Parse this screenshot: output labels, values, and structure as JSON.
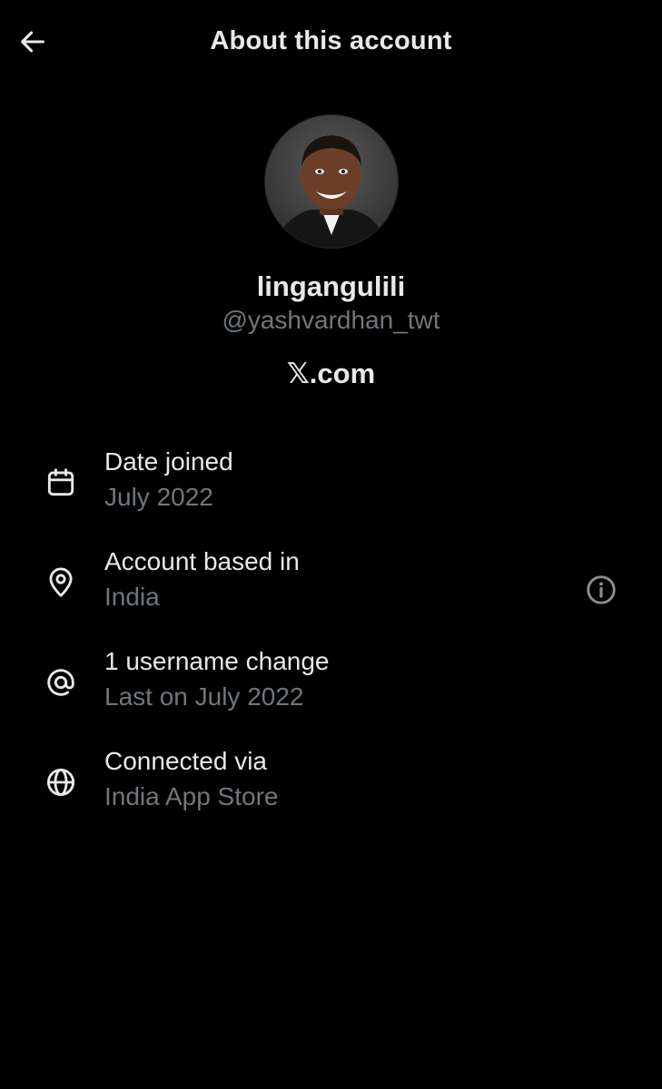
{
  "header": {
    "title": "About this account",
    "back_icon": "arrow-left-icon"
  },
  "profile": {
    "display_name": "lingangulili",
    "handle": "@yashvardhan_twt",
    "domain": "𝕏.com"
  },
  "details": [
    {
      "icon": "calendar-icon",
      "label": "Date joined",
      "value": "July 2022"
    },
    {
      "icon": "location-pin-icon",
      "label": "Account based in",
      "value": "India",
      "info_icon": "info-icon"
    },
    {
      "icon": "at-sign-icon",
      "label": "1 username change",
      "value": "Last on July 2022"
    },
    {
      "icon": "globe-icon",
      "label": "Connected via",
      "value": "India App Store"
    }
  ],
  "colors": {
    "background": "#000000",
    "primary_text": "#e7e9ea",
    "secondary_text": "#71767b"
  }
}
